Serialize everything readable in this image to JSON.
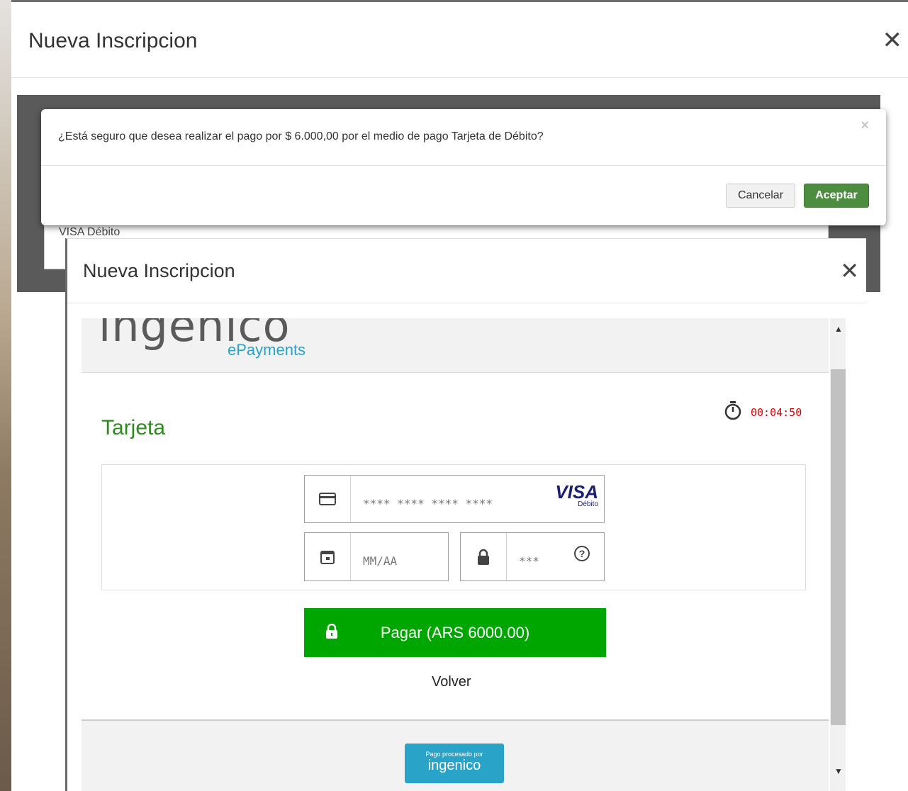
{
  "background_modal": {
    "title": "Nueva Inscripcion",
    "inner_label": "VISA Débito"
  },
  "confirm_dialog": {
    "message": "¿Está seguro que desea realizar el pago por $ 6.000,00 por el medio de pago Tarjeta de Débito?",
    "close": "×",
    "cancel_label": "Cancelar",
    "accept_label": "Aceptar"
  },
  "front_modal": {
    "title": "Nueva Inscripcion",
    "close": "×"
  },
  "payment": {
    "logo_word": "ingenico",
    "logo_sub": "ePayments",
    "timer": "00:04:50",
    "section_title": "Tarjeta",
    "card_number_placeholder": "**** **** **** ****",
    "card_brand": "VISA",
    "card_brand_sub": "Débito",
    "expiry_placeholder": "MM/AA",
    "cvv_placeholder": "***",
    "pay_label": "Pagar (ARS 6000.00)",
    "back_label": "Volver",
    "badge_top": "Pago procesado por",
    "badge_word": "ingenico"
  },
  "colors": {
    "accent_green": "#2e8b1e",
    "pay_button": "#00a600",
    "timer": "#e00000",
    "accept_button": "#4c8d3f",
    "ingenico_blue": "#2aa3c8"
  }
}
